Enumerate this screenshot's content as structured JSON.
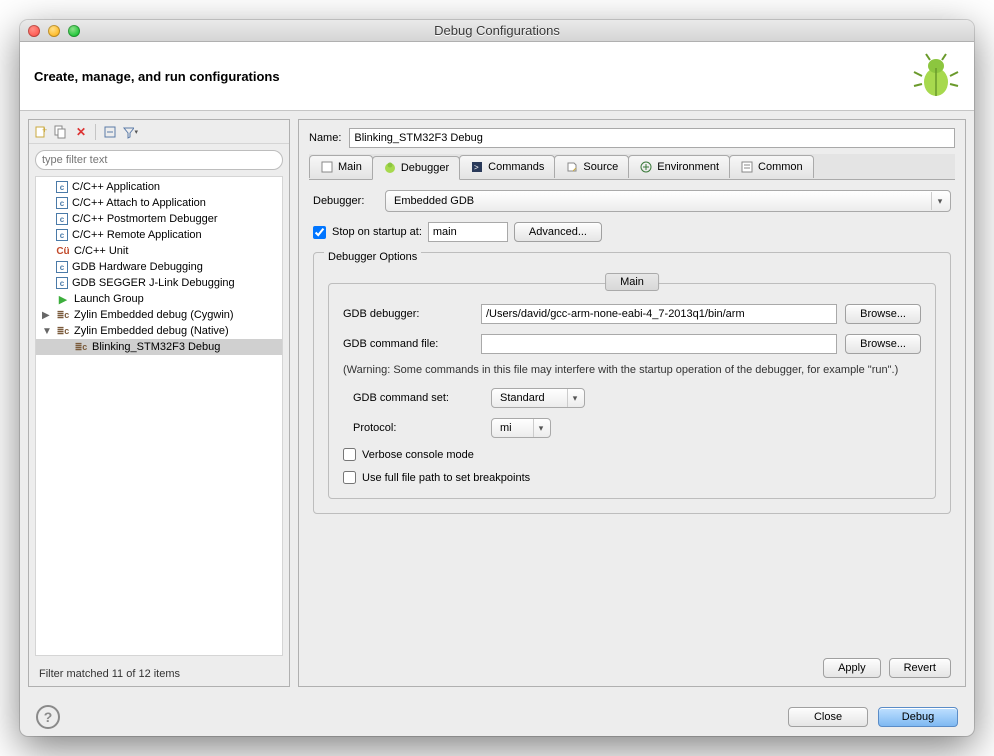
{
  "window": {
    "title": "Debug Configurations"
  },
  "header": {
    "title": "Create, manage, and run configurations"
  },
  "sidebar": {
    "filter_placeholder": "type filter text",
    "items": [
      {
        "label": "C/C++ Application",
        "icon": "c"
      },
      {
        "label": "C/C++ Attach to Application",
        "icon": "c"
      },
      {
        "label": "C/C++ Postmortem Debugger",
        "icon": "c"
      },
      {
        "label": "C/C++ Remote Application",
        "icon": "c"
      },
      {
        "label": "C/C++ Unit",
        "icon": "cu"
      },
      {
        "label": "GDB Hardware Debugging",
        "icon": "c"
      },
      {
        "label": "GDB SEGGER J-Link Debugging",
        "icon": "c"
      },
      {
        "label": "Launch Group",
        "icon": "play"
      },
      {
        "label": "Zylin Embedded debug (Cygwin)",
        "icon": "zylin"
      },
      {
        "label": "Zylin Embedded debug (Native)",
        "icon": "zylin",
        "expanded": true
      },
      {
        "label": "Blinking_STM32F3 Debug",
        "icon": "zylin",
        "indent": 1,
        "selected": true
      }
    ],
    "filter_status": "Filter matched 11 of 12 items"
  },
  "form": {
    "name_label": "Name:",
    "name_value": "Blinking_STM32F3 Debug",
    "tabs": [
      {
        "label": "Main"
      },
      {
        "label": "Debugger",
        "active": true
      },
      {
        "label": "Commands"
      },
      {
        "label": "Source"
      },
      {
        "label": "Environment"
      },
      {
        "label": "Common"
      }
    ],
    "debugger_label": "Debugger:",
    "debugger_value": "Embedded GDB",
    "stop_checkbox_label": "Stop on startup at:",
    "stop_value": "main",
    "advanced_button": "Advanced...",
    "options_legend": "Debugger Options",
    "inner_tab": "Main",
    "gdb_debugger_label": "GDB debugger:",
    "gdb_debugger_value": "/Users/david/gcc-arm-none-eabi-4_7-2013q1/bin/arm",
    "browse_button": "Browse...",
    "gdb_cmdfile_label": "GDB command file:",
    "gdb_cmdfile_value": "",
    "warning": "(Warning: Some commands in this file may interfere with the startup operation of the debugger, for example \"run\".)",
    "gdb_cmdset_label": "GDB command set:",
    "gdb_cmdset_value": "Standard",
    "protocol_label": "Protocol:",
    "protocol_value": "mi",
    "verbose_label": "Verbose console mode",
    "fullpath_label": "Use full file path to set breakpoints",
    "apply_button": "Apply",
    "revert_button": "Revert"
  },
  "footer": {
    "close_button": "Close",
    "debug_button": "Debug"
  }
}
